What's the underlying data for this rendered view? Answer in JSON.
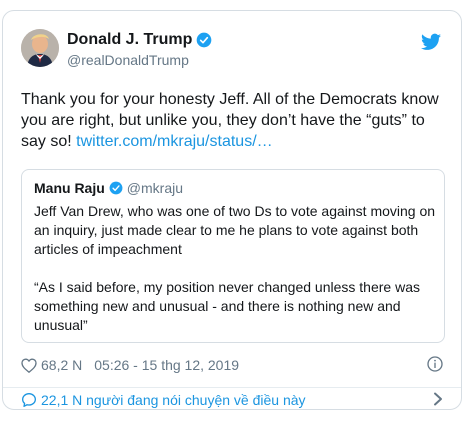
{
  "author": {
    "name": "Donald J. Trump",
    "handle": "@realDonaldTrump"
  },
  "tweet": {
    "text": "Thank you for your honesty Jeff. All of the Democrats know you are right, but unlike you, they don’t have the “guts” to say so! ",
    "link": "twitter.com/mkraju/status/…"
  },
  "quoted": {
    "name": "Manu Raju",
    "handle": "@mkraju",
    "paragraph1": "Jeff Van Drew, who was one of two Ds to vote against moving on an inquiry, just made clear to me he plans to vote against both articles of impeachment",
    "paragraph2": "“As I said before, my position never changed unless there was something new and unusual - and there is nothing new and unusual”"
  },
  "meta": {
    "likes": "68,2 N",
    "timestamp": "05:26 - 15 thg 12, 2019"
  },
  "footer": {
    "conversation": "22,1 N người đang nói chuyện về điều này"
  },
  "colors": {
    "accent": "#1b95e0",
    "verified": "#1da1f2",
    "muted": "#657786",
    "border": "#d6dde3"
  },
  "icons": [
    "avatar",
    "verified-icon",
    "twitter-bird-icon",
    "heart-icon",
    "info-icon",
    "speech-bubble-icon",
    "chevron-right-icon"
  ]
}
